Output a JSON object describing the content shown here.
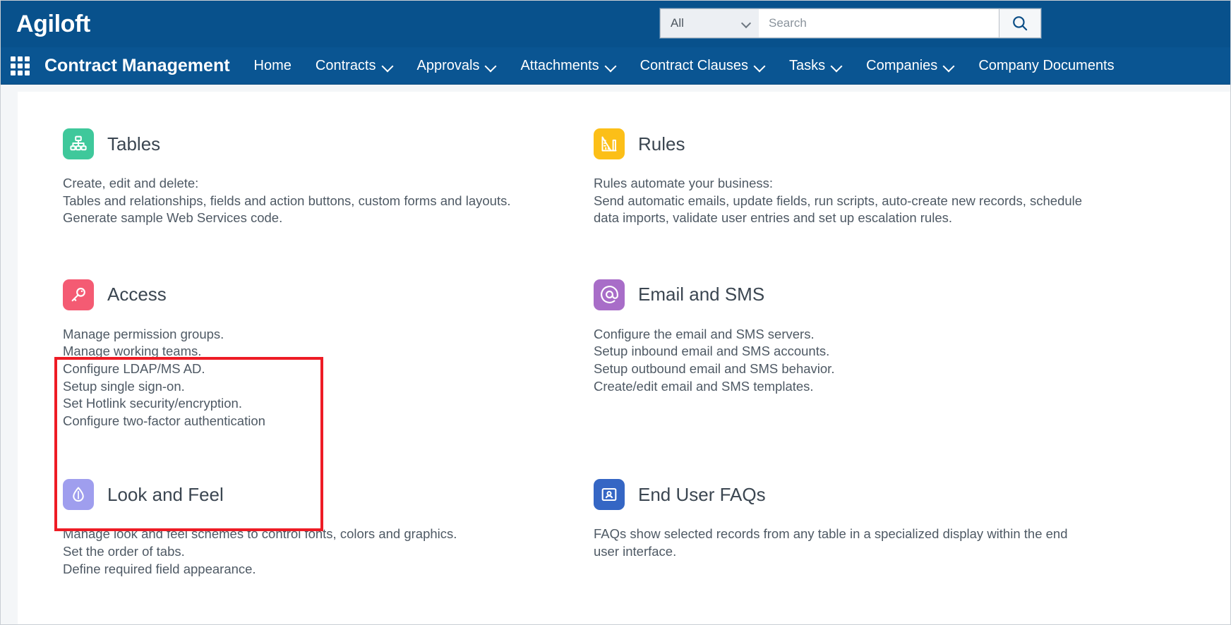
{
  "brand": {
    "name": "Agiloft"
  },
  "search": {
    "scope_selected": "All",
    "scope_options": [
      "All"
    ],
    "placeholder": "Search",
    "value": "",
    "button_icon": "search-icon"
  },
  "nav": {
    "grid_icon": "apps-grid-icon",
    "app_title": "Contract Management",
    "items": [
      {
        "label": "Home",
        "has_caret": false
      },
      {
        "label": "Contracts",
        "has_caret": true
      },
      {
        "label": "Approvals",
        "has_caret": true
      },
      {
        "label": "Attachments",
        "has_caret": true
      },
      {
        "label": "Contract Clauses",
        "has_caret": true
      },
      {
        "label": "Tasks",
        "has_caret": true
      },
      {
        "label": "Companies",
        "has_caret": true
      },
      {
        "label": "Company Documents",
        "has_caret": false
      }
    ]
  },
  "colors": {
    "header_blue": "#08518c",
    "nav_blue": "#0a5592",
    "highlight_red": "#ee1c25",
    "tables_green": "#3fc89b",
    "rules_yellow": "#fcbf18",
    "access_pink": "#f45b73",
    "email_purple": "#a86dc8",
    "look_periwinkle": "#9f9eee",
    "faq_blue": "#3566c4"
  },
  "tiles": [
    {
      "id": "tables",
      "title": "Tables",
      "icon": "hierarchy-icon",
      "icon_color": "#3fc89b",
      "lines": [
        "Create, edit and delete:",
        "Tables and relationships, fields and action buttons, custom forms and layouts.",
        "Generate sample Web Services code."
      ]
    },
    {
      "id": "rules",
      "title": "Rules",
      "icon": "ruler-icon",
      "icon_color": "#fcbf18",
      "lines": [
        "Rules automate your business:",
        "Send automatic emails, update fields, run scripts, auto-create new records, schedule",
        "data imports, validate user entries and set up escalation rules."
      ]
    },
    {
      "id": "access",
      "title": "Access",
      "icon": "key-icon",
      "icon_color": "#f45b73",
      "highlighted": true,
      "lines": [
        "Manage permission groups.",
        "Manage working teams.",
        "Configure LDAP/MS AD.",
        "Setup single sign-on.",
        "Set Hotlink security/encryption.",
        "Configure two-factor authentication"
      ]
    },
    {
      "id": "email-and-sms",
      "title": "Email and SMS",
      "icon": "at-sign-icon",
      "icon_color": "#a86dc8",
      "lines": [
        "Configure the email and SMS servers.",
        "Setup inbound email and SMS accounts.",
        "Setup outbound email and SMS behavior.",
        "Create/edit email and SMS templates."
      ]
    },
    {
      "id": "look-and-feel",
      "title": "Look and Feel",
      "icon": "droplet-icon",
      "icon_color": "#9f9eee",
      "lines": [
        "Manage look and feel schemes to control fonts, colors and graphics.",
        "Set the order of tabs.",
        "Define required field appearance."
      ]
    },
    {
      "id": "end-user-faqs",
      "title": "End User FAQs",
      "icon": "id-card-icon",
      "icon_color": "#3566c4",
      "lines": [
        "FAQs show selected records from any table in a specialized display within the end",
        "user interface."
      ]
    }
  ]
}
